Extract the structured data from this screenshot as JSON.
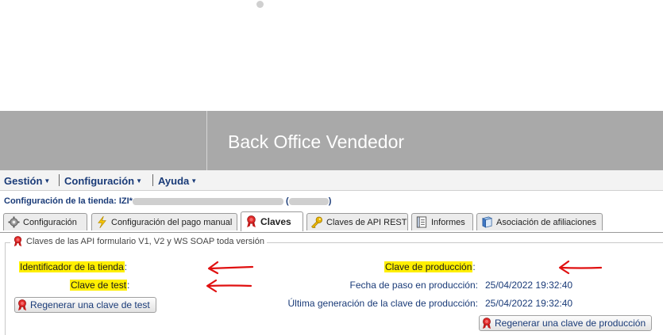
{
  "banner": {
    "title": "Back Office Vendedor"
  },
  "menu": {
    "items": [
      {
        "label": "Gestión"
      },
      {
        "label": "Configuración"
      },
      {
        "label": "Ayuda"
      }
    ]
  },
  "store": {
    "prefix": "Configuración de la tienda: IZI*",
    "paren_open": "(",
    "paren_close": ")"
  },
  "tabs": [
    {
      "label": "Configuración",
      "icon": "gear-icon"
    },
    {
      "label": "Configuración del pago manual",
      "icon": "lightning-icon"
    },
    {
      "label": "Claves",
      "icon": "ribbon-icon",
      "active": true
    },
    {
      "label": "Claves de API REST",
      "icon": "key-icon"
    },
    {
      "label": "Informes",
      "icon": "report-icon"
    },
    {
      "label": "Asociación de afiliaciones",
      "icon": "book-icon"
    }
  ],
  "keys_section": {
    "legend": "Claves de las API formulario V1, V2 y WS SOAP toda versión",
    "store_id_label": "Identificador de la tienda",
    "test_key_label": "Clave de test",
    "prod_key_label": "Clave de producción",
    "prod_date_label": "Fecha de paso en producción:",
    "prod_date_value": "25/04/2022 19:32:40",
    "last_gen_label": "Última generación de la clave de producción:",
    "last_gen_value": "25/04/2022 19:32:40",
    "colon": ":",
    "regen_test_button": "Regenerar una clave de test",
    "regen_prod_button": "Regenerar una clave de producción"
  },
  "colors": {
    "highlight": "#ffef00",
    "annotation_arrow": "#e01010",
    "link_blue": "#1a3b78",
    "banner": "#a9a9a9"
  }
}
